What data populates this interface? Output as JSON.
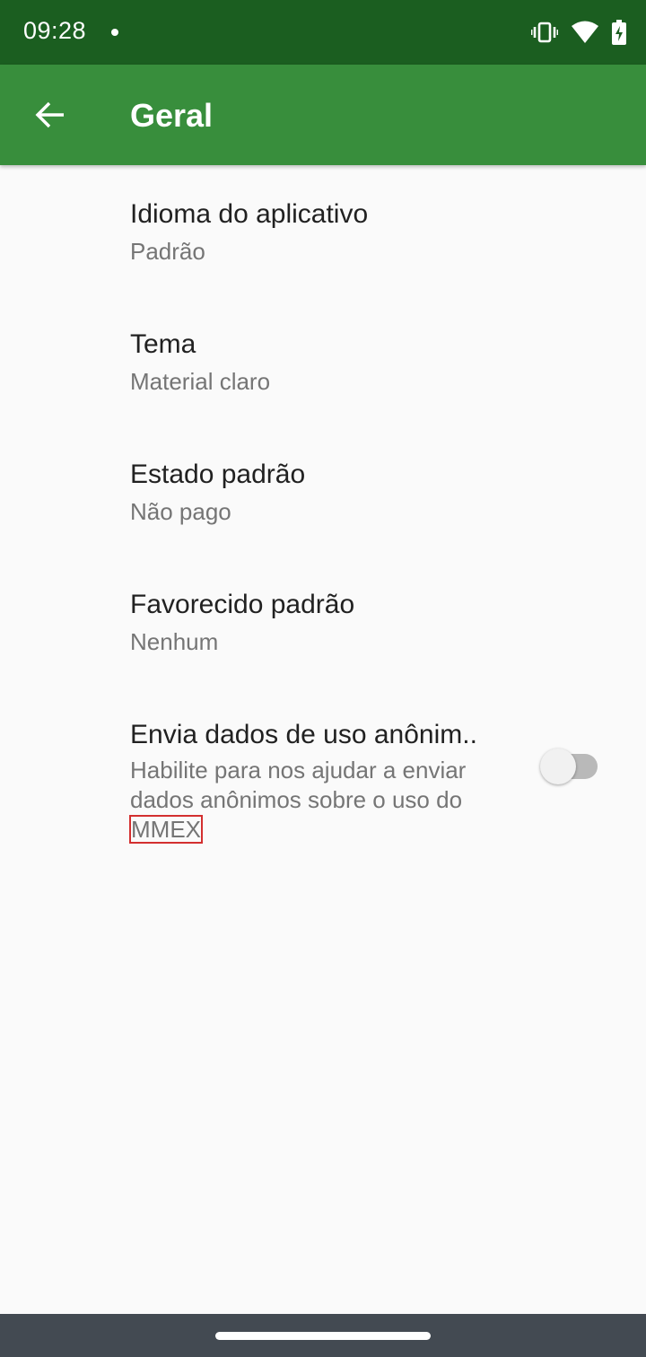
{
  "status_bar": {
    "time": "09:28",
    "icons": [
      "notification-dot-icon",
      "vibrate-icon",
      "wifi-icon",
      "battery-charging-icon"
    ]
  },
  "toolbar": {
    "title": "Geral",
    "back_icon": "arrow-back-icon"
  },
  "preferences": [
    {
      "title": "Idioma do aplicativo",
      "summary": "Padrão"
    },
    {
      "title": "Tema",
      "summary": "Material claro"
    },
    {
      "title": "Estado padrão",
      "summary": "Não pago"
    },
    {
      "title": "Favorecido padrão",
      "summary": "Nenhum"
    }
  ],
  "send_usage": {
    "title": "Envia dados de uso anônim..",
    "summary_text": "Habilite para nos ajudar a enviar dados anônimos sobre o uso do",
    "summary_app": "MMEX",
    "enabled": false
  },
  "colors": {
    "status_bar": "#1b5e20",
    "toolbar": "#388e3c",
    "background": "#fafafa",
    "nav_bar": "#434a52"
  }
}
